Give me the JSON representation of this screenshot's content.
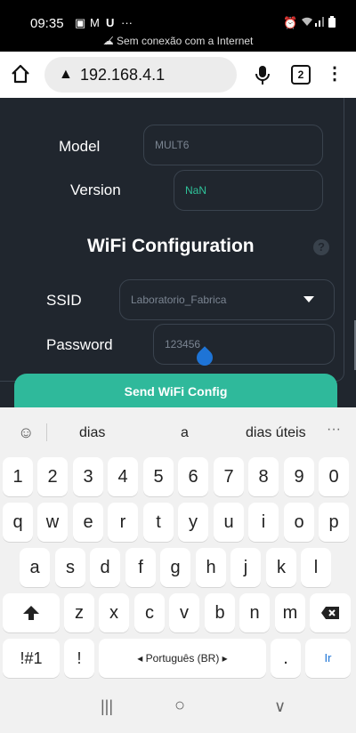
{
  "status_bar": {
    "time": "09:35",
    "left_icons": [
      "image-icon",
      "gmail-icon",
      "news-icon",
      "more-dots-icon"
    ],
    "offline_text": "Sem conexão com a Internet",
    "right_icons": [
      "alarm-icon",
      "wifi-icon",
      "signal-icon",
      "battery-icon"
    ]
  },
  "address_bar": {
    "url": "192.168.4.1",
    "tab_count": "2",
    "menu_glyph": "⋮"
  },
  "page": {
    "model_label": "Model",
    "model_value": "MULT6",
    "version_label": "Version",
    "version_value": "NaN",
    "wifi_title": "WiFi Configuration",
    "help_glyph": "?",
    "ssid_label": "SSID",
    "ssid_value": "Laboratorio_Fabrica",
    "password_label": "Password",
    "password_value": "123456",
    "send_button": "Send WiFi Config",
    "accent_color": "#2fb99b",
    "background_color": "#20262e"
  },
  "keyboard": {
    "suggestions": [
      "dias",
      "a",
      "dias úteis"
    ],
    "more_glyph": "···",
    "numbers": [
      "1",
      "2",
      "3",
      "4",
      "5",
      "6",
      "7",
      "8",
      "9",
      "0"
    ],
    "row_q": [
      "q",
      "w",
      "e",
      "r",
      "t",
      "y",
      "u",
      "i",
      "o",
      "p"
    ],
    "row_a": [
      "a",
      "s",
      "d",
      "f",
      "g",
      "h",
      "j",
      "k",
      "l"
    ],
    "row_z": [
      "z",
      "x",
      "c",
      "v",
      "b",
      "n",
      "m"
    ],
    "symbols_key": "!#1",
    "exclaim_key": "!",
    "language_key": "◂ Português (BR) ▸",
    "period_key": ".",
    "go_key": "Ir"
  },
  "nav_bar": {
    "recents": "|||",
    "home": "○",
    "back": "∨"
  }
}
